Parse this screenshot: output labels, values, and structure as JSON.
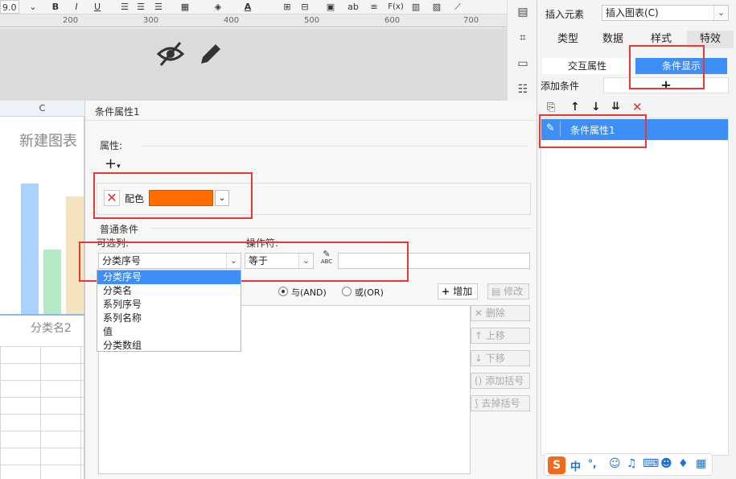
{
  "toolbar": {
    "font_size": "9.0",
    "buttons": [
      "B",
      "I",
      "U",
      "ab",
      "F(x)"
    ]
  },
  "ruler": {
    "marks": [
      "200",
      "300",
      "400",
      "500",
      "600",
      "700"
    ]
  },
  "spreadsheet": {
    "column": "C",
    "chart_title": "新建图表",
    "category_label": "分类名2"
  },
  "dialog": {
    "title": "条件属性1",
    "attributes_label": "属性:",
    "color_label": "配色",
    "color_value": "#ff6d00",
    "common_conditions_label": "普通条件",
    "selectable_column_label": "可选列:",
    "operator_label": "操作符:",
    "column_value": "分类序号",
    "operator_value": "等于",
    "abc_label": "ABC",
    "and_label": "与(AND)",
    "or_label": "或(OR)",
    "add_button": "增加",
    "modify_button": "修改",
    "delete_button": "删除",
    "move_up_button": "上移",
    "move_down_button": "下移",
    "add_bracket_button": "添加括号",
    "remove_bracket_button": "去掉括号",
    "dropdown_options": [
      "分类序号",
      "分类名",
      "系列序号",
      "系列名称",
      "值",
      "分类数组"
    ]
  },
  "right_panel": {
    "insert_element_label": "插入元素",
    "insert_chart_value": "插入图表(C)",
    "tabs": [
      "类型",
      "数据",
      "样式",
      "特效"
    ],
    "subtabs": [
      "交互属性",
      "条件显示"
    ],
    "add_condition_label": "添加条件",
    "add_symbol": "+",
    "condition_item": "条件属性1"
  },
  "ime": {
    "mode": "中",
    "punct": "°,"
  }
}
